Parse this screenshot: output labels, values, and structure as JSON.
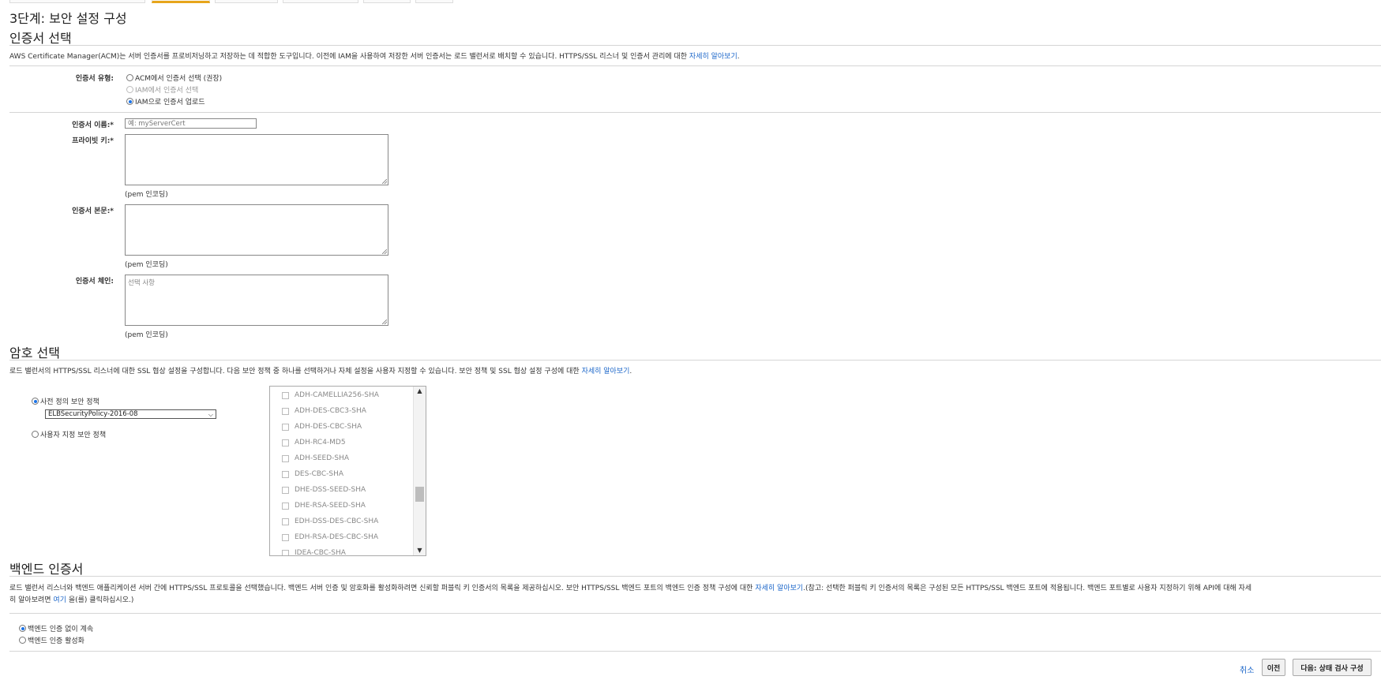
{
  "page": {
    "title": "3단계: 보안 설정 구성"
  },
  "cert_section": {
    "title": "인증서 선택",
    "description": "AWS Certificate Manager(ACM)는 서버 인증서를 프로비저닝하고 저장하는 데 적합한 도구입니다. 이전에 IAM을 사용하여 저장한 서버 인증서는 로드 밸런서로 배치할 수 있습니다. HTTPS/SSL 리스너 및 인증서 관리에 대한",
    "learn_more": "자세히 알아보기",
    "desc_end": ".",
    "type_label": "인증서 유형:",
    "type_options": [
      {
        "label": "ACM에서 인증서 선택 (권장)",
        "selected": false,
        "disabled": false
      },
      {
        "label": "IAM에서 인증서 선택",
        "selected": false,
        "disabled": true
      },
      {
        "label": "IAM으로 인증서 업로드",
        "selected": true,
        "disabled": false
      }
    ],
    "name_label": "인증서 이름:*",
    "name_placeholder": "예: myServerCert",
    "private_key_label": "프라이빗 키:*",
    "private_key_hint": "(pem 인코딩)",
    "body_label": "인증서 본문:*",
    "body_hint": "(pem 인코딩)",
    "chain_label": "인증서 체인:",
    "chain_placeholder": "선택 사항",
    "chain_hint": "(pem 인코딩)"
  },
  "cipher_section": {
    "title": "암호 선택",
    "description": "로드 밸런서의 HTTPS/SSL 리스너에 대한 SSL 협상 설정을 구성합니다. 다음 보안 정책 중 하나를 선택하거나 자체 설정을 사용자 지정할 수 있습니다. 보안 정책 및 SSL 협상 설정 구성에 대한",
    "learn_more": "자세히 알아보기",
    "desc_end": ".",
    "predefined_label": "사전 정의 보안 정책",
    "predefined_selected": true,
    "policy_value": "ELBSecurityPolicy-2016-08",
    "custom_label": "사용자 지정 보안 정책",
    "ciphers": [
      "ADH-CAMELLIA256-SHA",
      "ADH-DES-CBC3-SHA",
      "ADH-DES-CBC-SHA",
      "ADH-RC4-MD5",
      "ADH-SEED-SHA",
      "DES-CBC-SHA",
      "DHE-DSS-SEED-SHA",
      "DHE-RSA-SEED-SHA",
      "EDH-DSS-DES-CBC-SHA",
      "EDH-RSA-DES-CBC-SHA",
      "IDEA-CBC-SHA"
    ]
  },
  "backend_section": {
    "title": "백엔드 인증서",
    "description_line1": "로드 밸런서 리스너와 백엔드 애플리케이션 서버 간에 HTTPS/SSL 프로토콜을 선택했습니다. 백엔드 서버 인증 및 암호화를 활성화하려면 신뢰할 퍼블릭 키 인증서의 목록을 제공하십시오. 보안 HTTPS/SSL 백엔드 포트의 백엔드 인증 정책 구성에 대한",
    "learn_more": "자세히 알아보기",
    "description_line1_end": ".(참고: 선택한 퍼블릭 키 인증서의 목록은 구성된 모든 HTTPS/SSL 백엔드 포트에 적용됩니다. 백엔드 포트별로 사용자 지정하기 위해 API에 대해 자세",
    "description_line2_start": "히 알아보려면",
    "here_link": "여기",
    "description_line2_end": "을(를) 클릭하십시오.)",
    "options": [
      {
        "label": "백엔드 인증 없이 계속",
        "selected": true
      },
      {
        "label": "백엔드 인증 활성화",
        "selected": false
      }
    ]
  },
  "footer": {
    "cancel": "취소",
    "previous": "이전",
    "next": "다음: 상태 검사 구성"
  },
  "colors": {
    "link": "#1b66c9",
    "active_tab": "#e7a51b",
    "radio_selected": "#1a73e8"
  }
}
